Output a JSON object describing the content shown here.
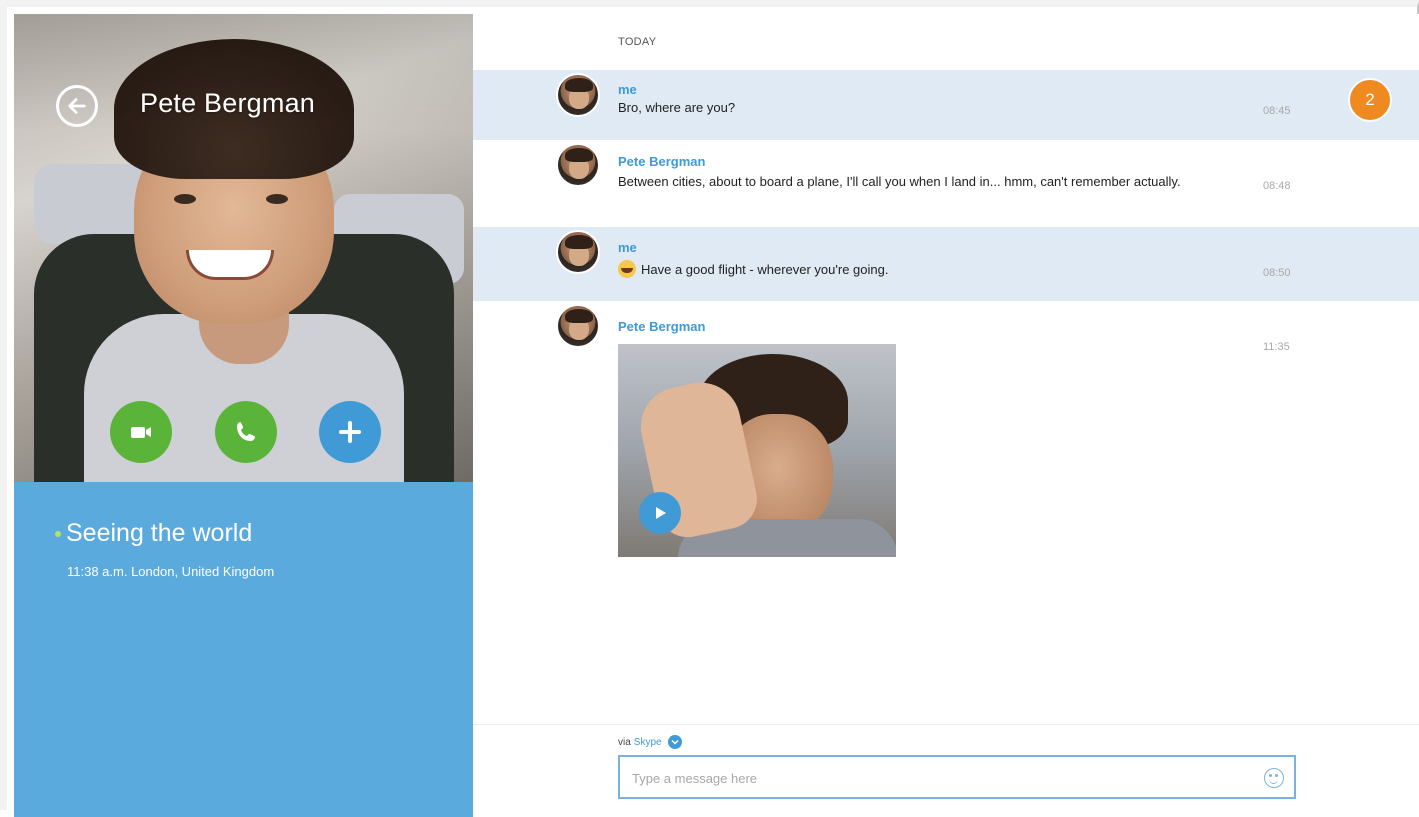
{
  "contact": {
    "name": "Pete Bergman",
    "status": "Seeing the world",
    "local_info": "11:38 a.m. London, United Kingdom"
  },
  "conversation": {
    "day_label": "TODAY",
    "unread_count": "2",
    "messages": [
      {
        "sender": "me",
        "text": "Bro, where are you?",
        "time": "08:45"
      },
      {
        "sender": "Pete Bergman",
        "text": "Between cities, about to board a plane, I'll call you when I land in... hmm, can't remember actually.",
        "time": "08:48"
      },
      {
        "sender": "me",
        "text": "Have a good flight - wherever you're going.",
        "time": "08:50"
      },
      {
        "sender": "Pete Bergman",
        "text": "",
        "time": "11:35",
        "attachment": "video"
      }
    ]
  },
  "composer": {
    "via_label": "via",
    "via_service": "Skype",
    "placeholder": "Type a message here"
  },
  "icons": {
    "back": "back-arrow-icon",
    "video_call": "video-camera-icon",
    "voice_call": "phone-icon",
    "add": "plus-icon",
    "play": "play-icon",
    "emoticon": "smiley-icon"
  },
  "colors": {
    "accent_blue": "#3f9ad6",
    "status_panel": "#5aaadd",
    "call_green": "#5bb43a",
    "badge_orange": "#ee8a20",
    "own_message_bg": "#dfeaf4"
  }
}
